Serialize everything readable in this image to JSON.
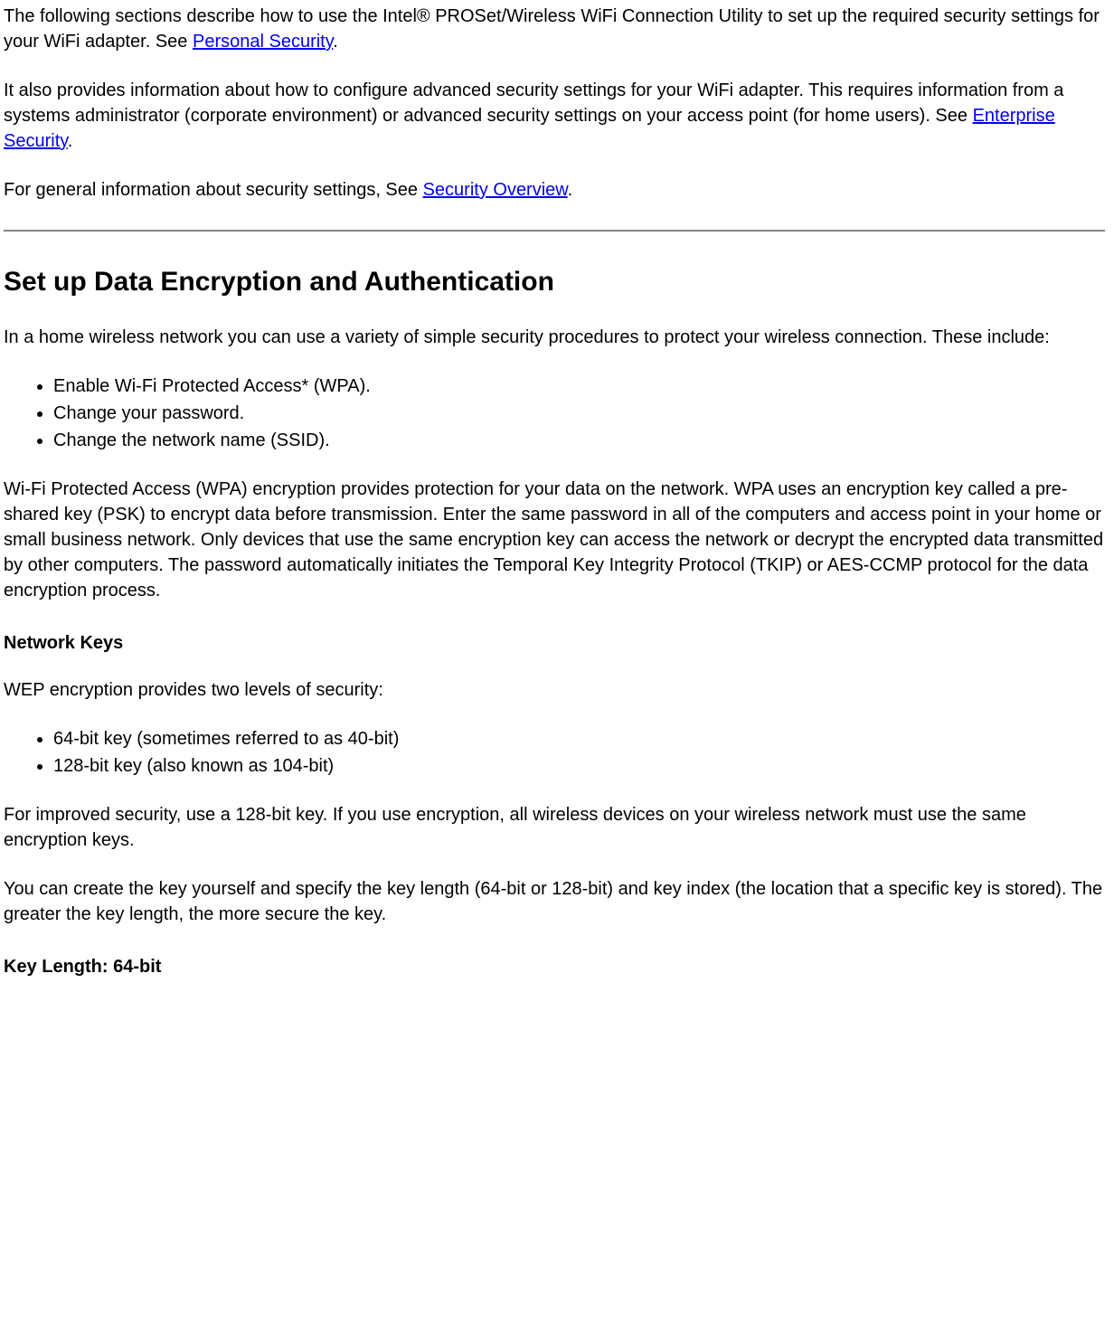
{
  "intro": {
    "p1_a": "The following sections describe how to use the Intel® PROSet/Wireless WiFi Connection Utility to set up the required security settings for your WiFi adapter. See ",
    "p1_link": "Personal Security",
    "p1_b": ".",
    "p2_a": "It also provides information about how to configure advanced security settings for your WiFi adapter. This requires information from a systems administrator (corporate environment) or advanced security settings on your access point (for home users). See ",
    "p2_link": "Enterprise Security",
    "p2_b": ".",
    "p3_a": "For general information about security settings, See ",
    "p3_link": "Security Overview",
    "p3_b": "."
  },
  "section": {
    "heading": "Set up Data Encryption and Authentication",
    "intro": "In a home wireless network you can use a variety of simple security procedures to protect your wireless connection. These include:",
    "procedures": [
      "Enable Wi-Fi Protected Access* (WPA).",
      "Change your password.",
      "Change the network name (SSID)."
    ],
    "wpa_paragraph": "Wi-Fi Protected Access (WPA) encryption provides protection for your data on the network. WPA uses an encryption key called a pre-shared key (PSK) to encrypt data before transmission. Enter the same password in all of the computers and access point in your home or small business network. Only devices that use the same encryption key can access the network or decrypt the encrypted data transmitted by other computers. The password automatically initiates the Temporal Key Integrity Protocol (TKIP) or AES-CCMP protocol for the data encryption process.",
    "network_keys_heading": "Network Keys",
    "wep_intro": "WEP encryption provides two levels of security:",
    "wep_levels": [
      "64-bit key (sometimes referred to as 40-bit)",
      "128-bit key (also known as 104-bit)"
    ],
    "wep_improved": "For improved security, use a 128-bit key. If you use encryption, all wireless devices on your wireless network must use the same encryption keys.",
    "wep_create": "You can create the key yourself and specify the key length (64-bit or 128-bit) and key index (the location that a specific key is stored). The greater the key length, the more secure the key.",
    "key_length_heading": "Key Length: 64-bit"
  }
}
